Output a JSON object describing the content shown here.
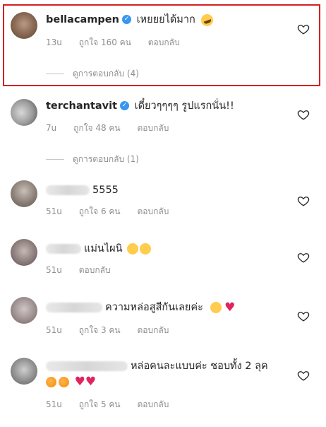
{
  "comments": [
    {
      "username": "bellacampen",
      "verified": true,
      "text": "เหยยยได้มาก",
      "emoji": "rofl-emoji",
      "time": "13u",
      "likes": "ถูกใจ 160 คน",
      "reply": "ตอบกลับ",
      "view_replies": "ดูการตอบกลับ (4)"
    },
    {
      "username": "terchantavit",
      "verified": true,
      "text": "เดี๋ยวๆๆๆๆ รูปแรกนั่น!!",
      "time": "7u",
      "likes": "ถูกใจ 48 คน",
      "reply": "ตอบกลับ",
      "view_replies": "ดูการตอบกลับ (1)"
    },
    {
      "username": "",
      "text": "5555",
      "time": "51u",
      "likes": "ถูกใจ 6 คน",
      "reply": "ตอบกลับ"
    },
    {
      "username": "",
      "text": "แม่นไผนิ",
      "emoji": "laughing-tears-emoji x2",
      "time": "51u",
      "reply": "ตอบกลับ"
    },
    {
      "username": "",
      "text": "ความหล่อสูสีกันเลยค่ะ",
      "emoji": "grin-emoji, red-heart",
      "time": "51u",
      "likes": "ถูกใจ 3 คน",
      "reply": "ตอบกลับ"
    },
    {
      "username": "",
      "text": "หล่อคนละแบบค่ะ ชอบทั้ง 2 ลุค",
      "emoji": "orange x2, red-heart x2",
      "time": "51u",
      "likes": "ถูกใจ 5 คน",
      "reply": "ตอบกลับ"
    }
  ],
  "colors": {
    "highlight_border": "#d42020",
    "verified_badge": "#3897f0",
    "meta_text": "#8e8e8e"
  }
}
